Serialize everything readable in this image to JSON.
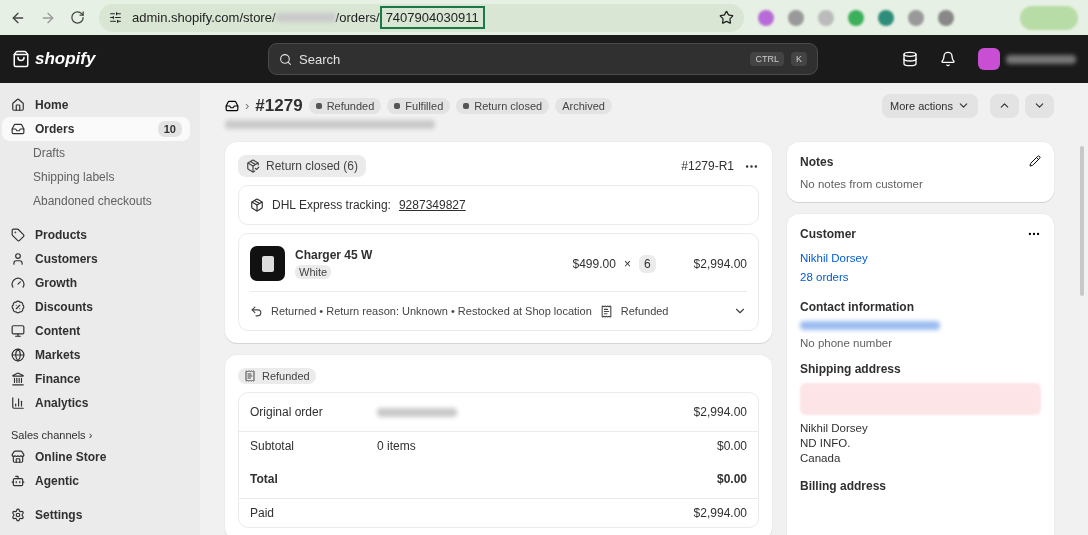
{
  "browser": {
    "url_start": "admin.shopify.com/store/",
    "url_mid": "/orders/",
    "url_id": "7407904030911",
    "id_highlighted": true
  },
  "topbar": {
    "logo": "shopify",
    "search_placeholder": "Search",
    "shortcut_keys": [
      "CTRL",
      "K"
    ]
  },
  "sidebar": {
    "items": [
      {
        "kind": "main",
        "label": "Home",
        "selected": false
      },
      {
        "kind": "main",
        "label": "Orders",
        "selected": true,
        "badge": "10"
      },
      {
        "kind": "sub",
        "label": "Drafts",
        "selected": false
      },
      {
        "kind": "sub",
        "label": "Shipping labels",
        "selected": false
      },
      {
        "kind": "sub",
        "label": "Abandoned checkouts",
        "selected": false
      },
      {
        "kind": "gap"
      },
      {
        "kind": "main",
        "label": "Products",
        "selected": false
      },
      {
        "kind": "main",
        "label": "Customers",
        "selected": false
      },
      {
        "kind": "main",
        "label": "Growth",
        "selected": false
      },
      {
        "kind": "main",
        "label": "Discounts",
        "selected": false
      },
      {
        "kind": "main",
        "label": "Content",
        "selected": false
      },
      {
        "kind": "main",
        "label": "Markets",
        "selected": false
      },
      {
        "kind": "main",
        "label": "Finance",
        "selected": false
      },
      {
        "kind": "main",
        "label": "Analytics",
        "selected": false
      },
      {
        "kind": "section",
        "label": "Sales channels",
        "arrow": "›"
      },
      {
        "kind": "main",
        "label": "Online Store",
        "selected": false
      },
      {
        "kind": "main",
        "label": "Agentic",
        "selected": false
      },
      {
        "kind": "gap"
      },
      {
        "kind": "main",
        "label": "Settings",
        "selected": false
      }
    ]
  },
  "header": {
    "separator": "›",
    "order": "#1279",
    "badges": [
      {
        "label": "Refunded",
        "dot": true
      },
      {
        "label": "Fulfilled",
        "dot": true
      },
      {
        "label": "Return closed",
        "dot": true
      },
      {
        "label": "Archived",
        "dot": false
      }
    ],
    "more_actions": "More actions"
  },
  "return_card": {
    "status": "Return closed (6)",
    "return_id": "#1279-R1",
    "tracking_label": "DHL Express tracking:",
    "tracking_number": "9287349827",
    "item": {
      "name": "Charger 45 W",
      "variant": "White",
      "price": "$499.00",
      "times": "×",
      "qty": "6",
      "total": "$2,994.00"
    },
    "footer": {
      "text": "Returned • Return reason: Unknown • Restocked at Shop location",
      "refund_status": "Refunded"
    }
  },
  "refund_card": {
    "status": "Refunded",
    "rows": [
      {
        "kind": "dated",
        "label": "Original order",
        "amount": "$2,994.00"
      },
      {
        "kind": "row",
        "label": "Subtotal",
        "detail": "0 items",
        "amount": "$0.00"
      },
      {
        "kind": "total",
        "label": "Total",
        "amount": "$0.00"
      },
      {
        "kind": "row",
        "label": "Paid",
        "amount": "$2,994.00"
      }
    ]
  },
  "notes": {
    "title": "Notes",
    "text": "No notes from customer"
  },
  "customer": {
    "title": "Customer",
    "name": "Nikhil Dorsey",
    "orders": "28 orders",
    "contact_title": "Contact information",
    "phone": "No phone number",
    "shipping_title": "Shipping address",
    "address_lines": [
      "Nikhil Dorsey",
      "ND INFO.",
      "Canada"
    ],
    "billing_title": "Billing address"
  }
}
